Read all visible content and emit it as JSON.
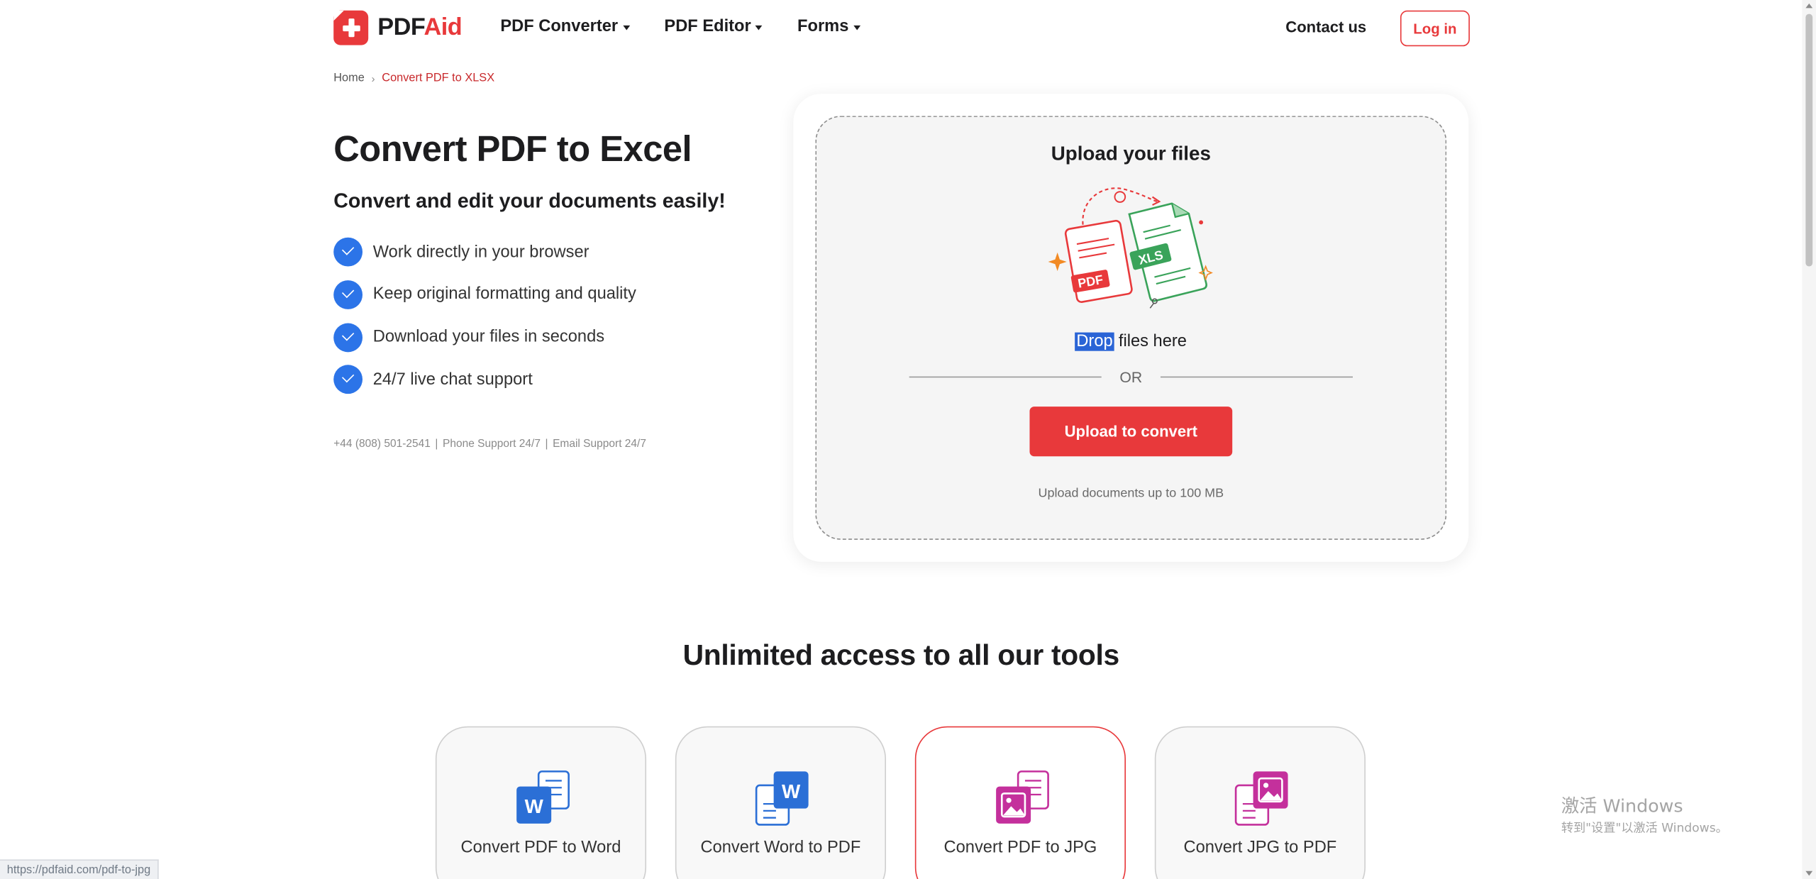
{
  "header": {
    "logo_pdf": "PDF",
    "logo_aid": "Aid",
    "nav": [
      {
        "label": "PDF Converter"
      },
      {
        "label": "PDF Editor"
      },
      {
        "label": "Forms"
      }
    ],
    "contact_label": "Contact us",
    "login_label": "Log in"
  },
  "breadcrumb": {
    "home": "Home",
    "current": "Convert PDF to XLSX"
  },
  "hero": {
    "title": "Convert PDF to Excel",
    "subtitle": "Convert and edit your documents easily!",
    "features": [
      "Work directly in your browser",
      "Keep original formatting and quality",
      "Download your files in seconds",
      "24/7 live chat support"
    ],
    "support_phone": "+44 (808) 501-2541",
    "support_phone_note": "Phone Support 24/7",
    "support_email_note": "Email Support 24/7"
  },
  "upload": {
    "title": "Upload your files",
    "drop_highlight": "Drop",
    "drop_rest": " files here",
    "or_label": "OR",
    "button_label": "Upload to convert",
    "note": "Upload documents up to 100 MB",
    "illustration_pdf_label": "PDF",
    "illustration_xls_label": "XLS"
  },
  "tools": {
    "title": "Unlimited access to all our tools",
    "items": [
      {
        "label": "Convert PDF to Word",
        "icon": "pdf-to-word-icon",
        "letter": "W",
        "color": "#2b6fd6",
        "active": false
      },
      {
        "label": "Convert Word to PDF",
        "icon": "word-to-pdf-icon",
        "letter": "W",
        "color": "#2b6fd6",
        "active": false
      },
      {
        "label": "Convert PDF to JPG",
        "icon": "pdf-to-jpg-icon",
        "color": "#c4309c",
        "active": true
      },
      {
        "label": "Convert JPG to PDF",
        "icon": "jpg-to-pdf-icon",
        "color": "#c4309c",
        "active": false
      }
    ]
  },
  "status_bar": {
    "url": "https://pdfaid.com/pdf-to-jpg"
  },
  "watermark": {
    "line1": "激活 Windows",
    "line2": "转到\"设置\"以激活 Windows。"
  },
  "colors": {
    "brand_red": "#e8393b",
    "check_blue": "#2c74e8",
    "word_blue": "#2b6fd6",
    "image_magenta": "#c4309c"
  }
}
